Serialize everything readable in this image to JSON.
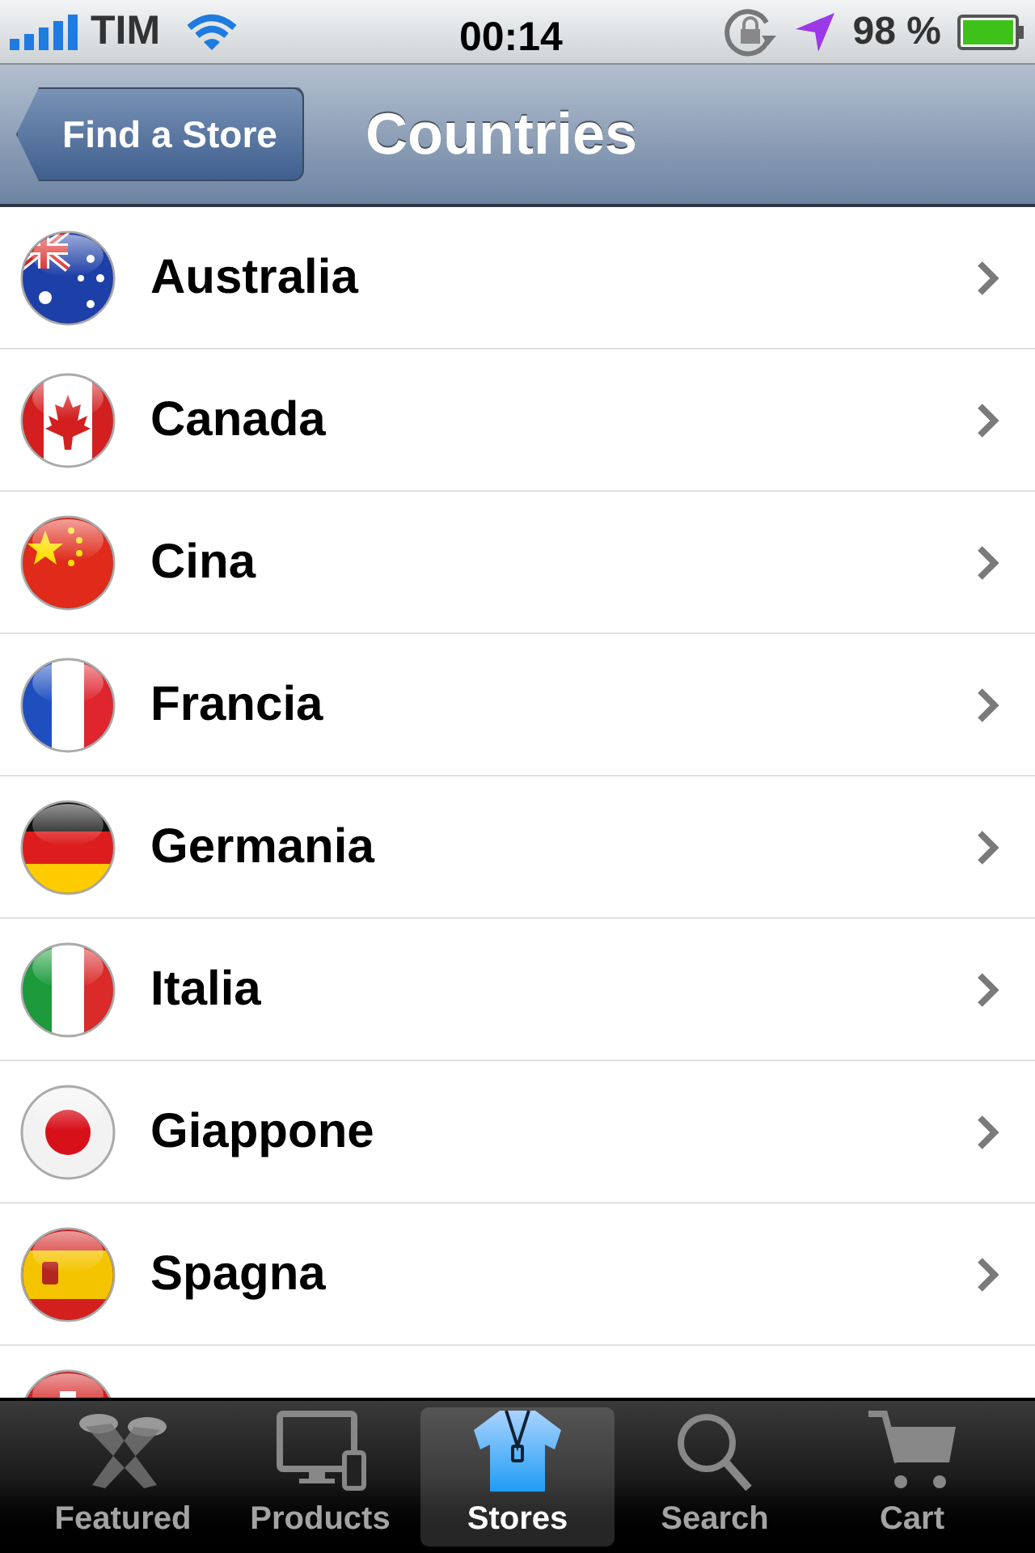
{
  "status_bar": {
    "carrier": "TIM",
    "time": "00:14",
    "battery": "98 %"
  },
  "nav_bar": {
    "back_button": "Find a Store",
    "title": "Countries"
  },
  "countries": [
    {
      "kind": "au",
      "label": "Australia"
    },
    {
      "kind": "ca",
      "label": "Canada"
    },
    {
      "kind": "cn",
      "label": "Cina"
    },
    {
      "kind": "fr",
      "label": "Francia"
    },
    {
      "kind": "de",
      "label": "Germania"
    },
    {
      "kind": "it",
      "label": "Italia"
    },
    {
      "kind": "jp",
      "label": "Giappone"
    },
    {
      "kind": "es",
      "label": "Spagna"
    },
    {
      "kind": "ch"
    }
  ],
  "tab_bar": [
    {
      "kind": "featured",
      "label": "Featured",
      "selected": false
    },
    {
      "kind": "products",
      "label": "Products",
      "selected": false
    },
    {
      "kind": "stores",
      "label": "Stores",
      "selected": true
    },
    {
      "kind": "search",
      "label": "Search",
      "selected": false
    },
    {
      "kind": "cart",
      "label": "Cart",
      "selected": false
    }
  ]
}
